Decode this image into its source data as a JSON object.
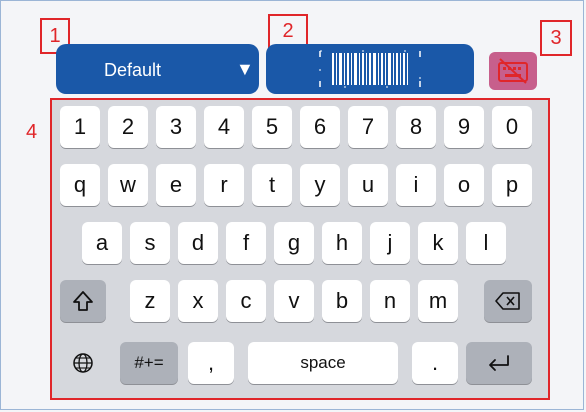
{
  "callouts": [
    "1",
    "2",
    "3",
    "4"
  ],
  "toolbar": {
    "dropdown_value": "Default",
    "dropdown_arrow": "▼",
    "barcode_icon": "barcode-scan-icon",
    "keyboard_icon": "keyboard-toggle-icon"
  },
  "keyboard": {
    "row1": [
      "1",
      "2",
      "3",
      "4",
      "5",
      "6",
      "7",
      "8",
      "9",
      "0"
    ],
    "row2": [
      "q",
      "w",
      "e",
      "r",
      "t",
      "y",
      "u",
      "i",
      "o",
      "p"
    ],
    "row3": [
      "a",
      "s",
      "d",
      "f",
      "g",
      "h",
      "j",
      "k",
      "l"
    ],
    "row4": [
      "z",
      "x",
      "c",
      "v",
      "b",
      "n",
      "m"
    ],
    "symbols_label": "#+=",
    "comma": ",",
    "space_label": "space",
    "period": ".",
    "shift_icon": "shift-icon",
    "backspace_icon": "backspace-icon",
    "globe_icon": "globe-icon",
    "return_icon": "return-icon"
  },
  "colors": {
    "accent_blue": "#1a58a8",
    "callout_red": "#e0262a",
    "keyboard_bg": "#d6d8dd",
    "key_gray": "#adb1b9"
  }
}
